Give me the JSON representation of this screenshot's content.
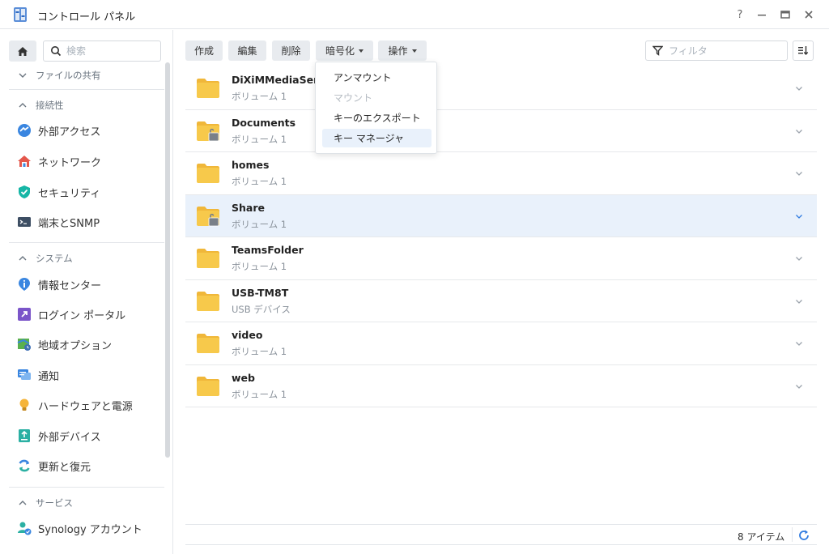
{
  "window": {
    "title": "コントロール パネル",
    "help_label": "?"
  },
  "sidebar": {
    "search_placeholder": "検索",
    "sections": [
      {
        "label": "ファイルの共有"
      },
      {
        "label": "接続性"
      },
      {
        "label": "システム"
      },
      {
        "label": "サービス"
      }
    ],
    "items": [
      {
        "label": "外部アクセス",
        "icon": "external-access-icon"
      },
      {
        "label": "ネットワーク",
        "icon": "network-icon"
      },
      {
        "label": "セキュリティ",
        "icon": "security-shield-icon"
      },
      {
        "label": "端末とSNMP",
        "icon": "terminal-icon"
      },
      {
        "label": "情報センター",
        "icon": "info-center-icon"
      },
      {
        "label": "ログイン ポータル",
        "icon": "login-portal-icon"
      },
      {
        "label": "地域オプション",
        "icon": "regional-options-icon"
      },
      {
        "label": "通知",
        "icon": "notification-icon"
      },
      {
        "label": "ハードウェアと電源",
        "icon": "hardware-power-icon"
      },
      {
        "label": "外部デバイス",
        "icon": "external-device-icon"
      },
      {
        "label": "更新と復元",
        "icon": "update-restore-icon"
      },
      {
        "label": "Synology アカウント",
        "icon": "synology-account-icon"
      }
    ]
  },
  "toolbar": {
    "create": "作成",
    "edit": "編集",
    "delete": "削除",
    "encryption": "暗号化",
    "action": "操作",
    "filter_placeholder": "フィルタ"
  },
  "encryption_menu": {
    "items": [
      {
        "label": "アンマウント",
        "state": "enabled"
      },
      {
        "label": "マウント",
        "state": "disabled"
      },
      {
        "label": "キーのエクスポート",
        "state": "enabled"
      },
      {
        "label": "キー マネージャ",
        "state": "hover"
      }
    ]
  },
  "shares": [
    {
      "name": "DiXiMMediaServ",
      "location": "ボリューム 1",
      "locked": false,
      "selected": false
    },
    {
      "name": "Documents",
      "location": "ボリューム 1",
      "locked": true,
      "selected": false
    },
    {
      "name": "homes",
      "location": "ボリューム 1",
      "locked": false,
      "selected": false
    },
    {
      "name": "Share",
      "location": "ボリューム 1",
      "locked": true,
      "selected": true
    },
    {
      "name": "TeamsFolder",
      "location": "ボリューム 1",
      "locked": false,
      "selected": false
    },
    {
      "name": "USB-TM8T",
      "location": "USB デバイス",
      "locked": false,
      "selected": false
    },
    {
      "name": "video",
      "location": "ボリューム 1",
      "locked": false,
      "selected": false
    },
    {
      "name": "web",
      "location": "ボリューム 1",
      "locked": false,
      "selected": false
    }
  ],
  "footer": {
    "item_count": "8 アイテム"
  },
  "colors": {
    "accent": "#2f7be0",
    "folder": "#f7c94b",
    "folder_dark": "#f0b73a",
    "selected_row": "#e9f1fb"
  }
}
